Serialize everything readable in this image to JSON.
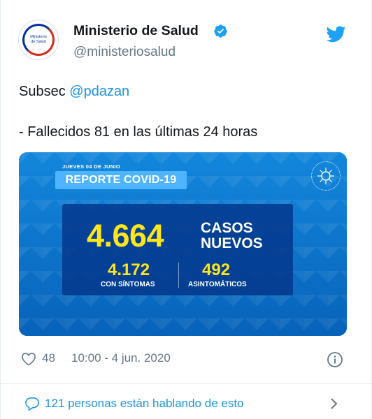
{
  "header": {
    "name": "Ministerio de Salud",
    "handle": "@ministeriosalud",
    "avatar_text": [
      "Ministerio",
      "de Salud"
    ]
  },
  "tweet": {
    "prefix": "Subsec ",
    "mention": "@pdazan",
    "line2": "- Fallecidos 81 en las últimas 24 horas"
  },
  "report": {
    "date": "JUEVES 04 DE JUNIO",
    "title": "REPORTE COVID-19",
    "total": "4.664",
    "total_label_1": "CASOS",
    "total_label_2": "NUEVOS",
    "symptomatic": "4.172",
    "symptomatic_label": "CON SÍNTOMAS",
    "asymptomatic": "492",
    "asymptomatic_label": "ASINTOMÁTICOS",
    "logo_text": "CORONAVIRUS"
  },
  "meta": {
    "likes": "48",
    "timestamp": "10:00 - 4 jun. 2020"
  },
  "footer": {
    "talking": "121 personas están hablando de esto"
  },
  "colors": {
    "twitter_blue": "#1da1f2",
    "link": "#1b95e0",
    "muted": "#657786",
    "yellow": "#ffe51a"
  }
}
